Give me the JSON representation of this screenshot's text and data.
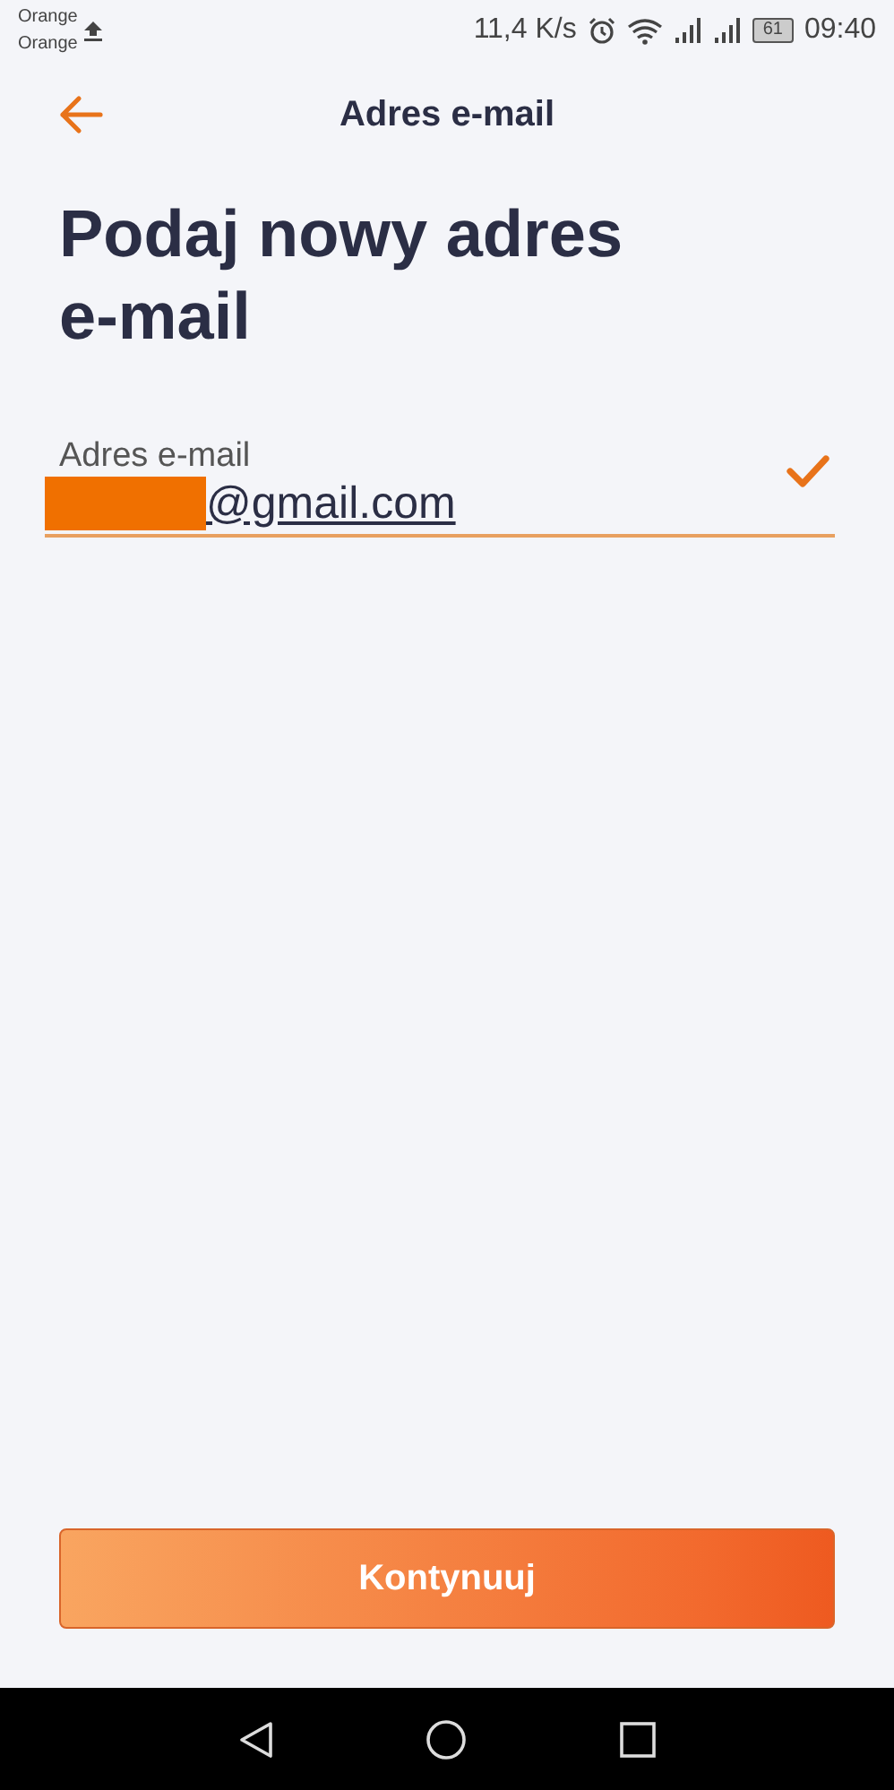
{
  "status_bar": {
    "carriers": [
      "Orange",
      "Orange"
    ],
    "speed": "11,4 K/s",
    "battery": "61",
    "time": "09:40"
  },
  "header": {
    "title": "Adres e-mail"
  },
  "heading": "Podaj nowy adres e-mail",
  "email_field": {
    "label": "Adres e-mail",
    "value": "@gmail.com",
    "redacted": true,
    "valid": true
  },
  "primary_button": {
    "label": "Kontynuuj"
  }
}
